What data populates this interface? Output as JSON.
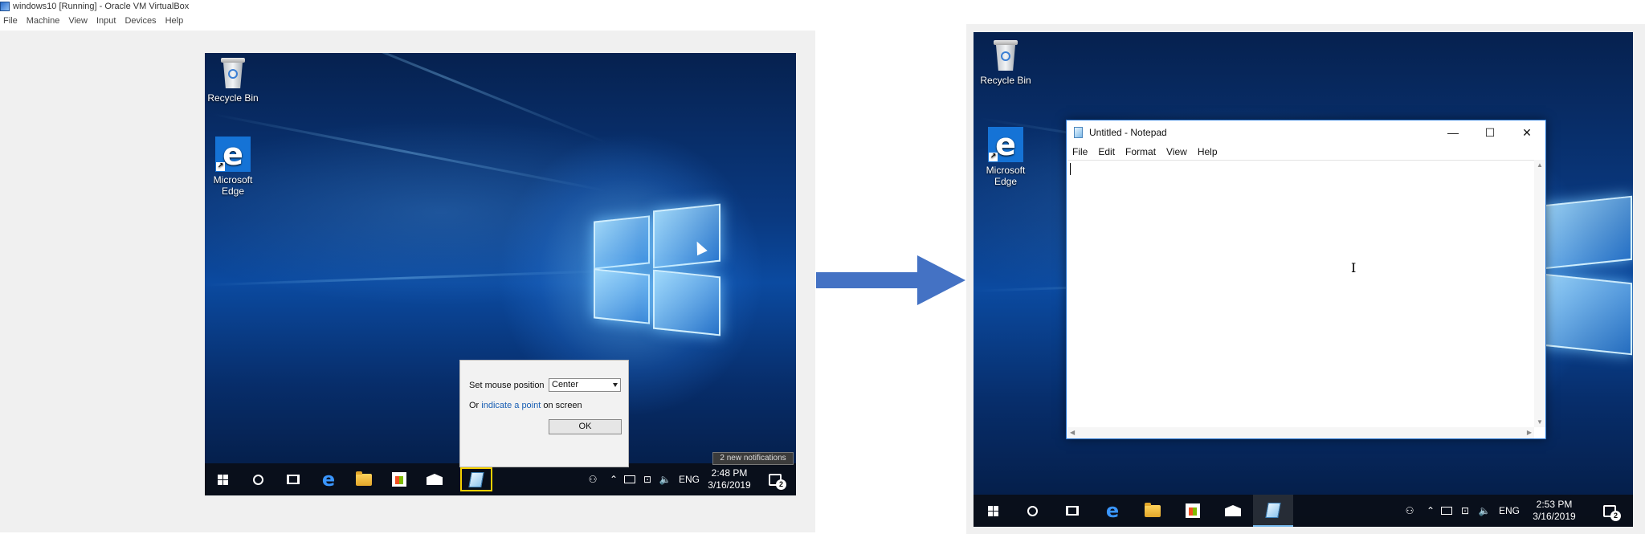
{
  "vbox": {
    "title": "windows10 [Running] - Oracle VM VirtualBox",
    "menu": [
      "File",
      "Machine",
      "View",
      "Input",
      "Devices",
      "Help"
    ]
  },
  "desktop_icons": {
    "recycle_bin": "Recycle Bin",
    "edge_line1": "Microsoft",
    "edge_line2": "Edge"
  },
  "mouse_dialog": {
    "label": "Set mouse position",
    "select_value": "Center",
    "or_text": "Or",
    "link_text": "indicate a point",
    "on_screen_text": "on screen",
    "ok_label": "OK"
  },
  "notification_toast": "2 new notifications",
  "left_taskbar": {
    "lang": "ENG",
    "time": "2:48 PM",
    "date": "3/16/2019",
    "badge": "2"
  },
  "notepad": {
    "title": "Untitled - Notepad",
    "menu": [
      "File",
      "Edit",
      "Format",
      "View",
      "Help"
    ],
    "controls": {
      "minimize": "—",
      "maximize": "☐",
      "close": "✕"
    }
  },
  "right_taskbar": {
    "lang": "ENG",
    "time": "2:53 PM",
    "date": "3/16/2019",
    "badge": "2"
  },
  "colors": {
    "arrow": "#4472c4",
    "highlight": "#f5d000",
    "link": "#1a5fb4"
  },
  "icons": [
    "start-icon",
    "cortana-icon",
    "task-view-icon",
    "edge-icon",
    "file-explorer-icon",
    "store-icon",
    "mail-icon",
    "notepad-icon",
    "people-icon",
    "chevron-up-icon",
    "battery-icon",
    "network-icon",
    "volume-icon",
    "action-center-icon"
  ]
}
